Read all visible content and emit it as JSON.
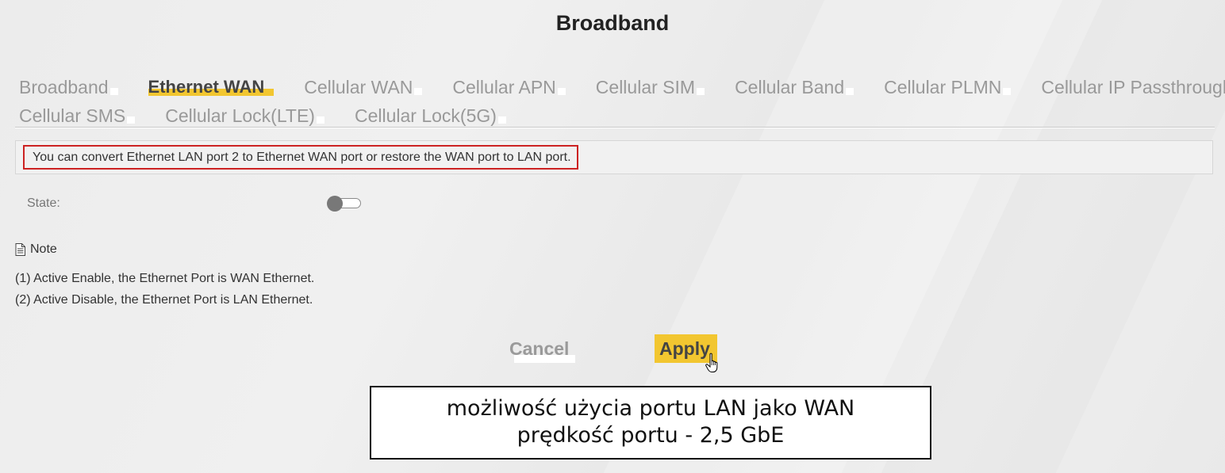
{
  "page": {
    "title": "Broadband"
  },
  "tabs": {
    "row1": [
      {
        "label": "Broadband",
        "active": false
      },
      {
        "label": "Ethernet WAN",
        "active": true
      },
      {
        "label": "Cellular WAN",
        "active": false
      },
      {
        "label": "Cellular APN",
        "active": false
      },
      {
        "label": "Cellular SIM",
        "active": false
      },
      {
        "label": "Cellular Band",
        "active": false
      },
      {
        "label": "Cellular PLMN",
        "active": false
      },
      {
        "label": "Cellular IP Passthrough",
        "active": false
      }
    ],
    "row2": [
      {
        "label": "Cellular SMS",
        "active": false
      },
      {
        "label": "Cellular Lock(LTE)",
        "active": false
      },
      {
        "label": "Cellular Lock(5G)",
        "active": false
      }
    ]
  },
  "info": {
    "message": "You can convert Ethernet LAN port 2 to Ethernet WAN port or restore the WAN port to LAN port."
  },
  "form": {
    "state_label": "State:",
    "state_enabled": false
  },
  "note": {
    "title": "Note",
    "lines": [
      "(1) Active Enable, the Ethernet Port is WAN Ethernet.",
      "(2) Active Disable, the Ethernet Port is LAN Ethernet."
    ]
  },
  "actions": {
    "cancel_label": "Cancel",
    "apply_label": "Apply"
  },
  "callout": {
    "line1": "możliwość użycia portu LAN jako WAN",
    "line2": "prędkość portu - 2,5 GbE"
  },
  "colors": {
    "accent": "#f2c630",
    "highlight_border": "#cc2222",
    "tab_inactive": "#999999",
    "toggle_knob": "#787878"
  },
  "icons": {
    "note": "document-icon",
    "cursor": "hand-pointer-icon"
  }
}
